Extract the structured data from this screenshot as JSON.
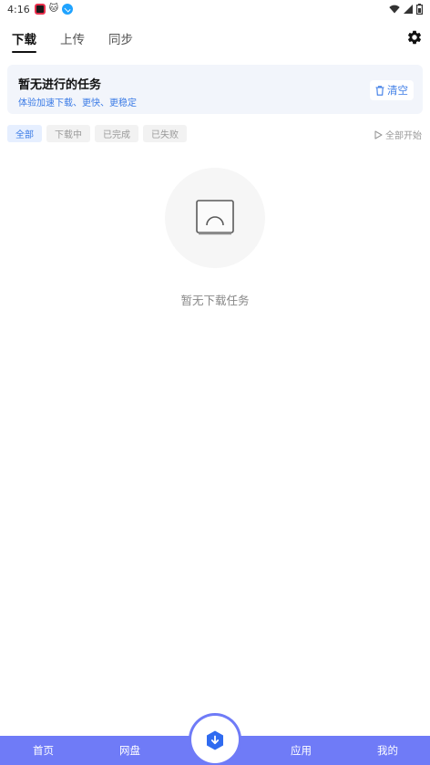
{
  "status_bar": {
    "time": "4:16"
  },
  "tabs": [
    {
      "label": "下载",
      "active": true
    },
    {
      "label": "上传",
      "active": false
    },
    {
      "label": "同步",
      "active": false
    }
  ],
  "banner": {
    "title": "暂无进行的任务",
    "subtitle": "体验加速下载、更快、更稳定",
    "clear_label": "清空"
  },
  "filters": [
    {
      "label": "全部",
      "active": true
    },
    {
      "label": "下载中",
      "active": false
    },
    {
      "label": "已完成",
      "active": false
    },
    {
      "label": "已失败",
      "active": false
    }
  ],
  "start_all_label": "全部开始",
  "empty": {
    "text": "暂无下载任务"
  },
  "bottom_nav": [
    {
      "label": "首页"
    },
    {
      "label": "网盘"
    },
    {
      "label": "应用"
    },
    {
      "label": "我的"
    }
  ],
  "colors": {
    "accent": "#3b7be6",
    "nav_bar": "#6f7bf7",
    "center_button": "#2f6bf0"
  }
}
